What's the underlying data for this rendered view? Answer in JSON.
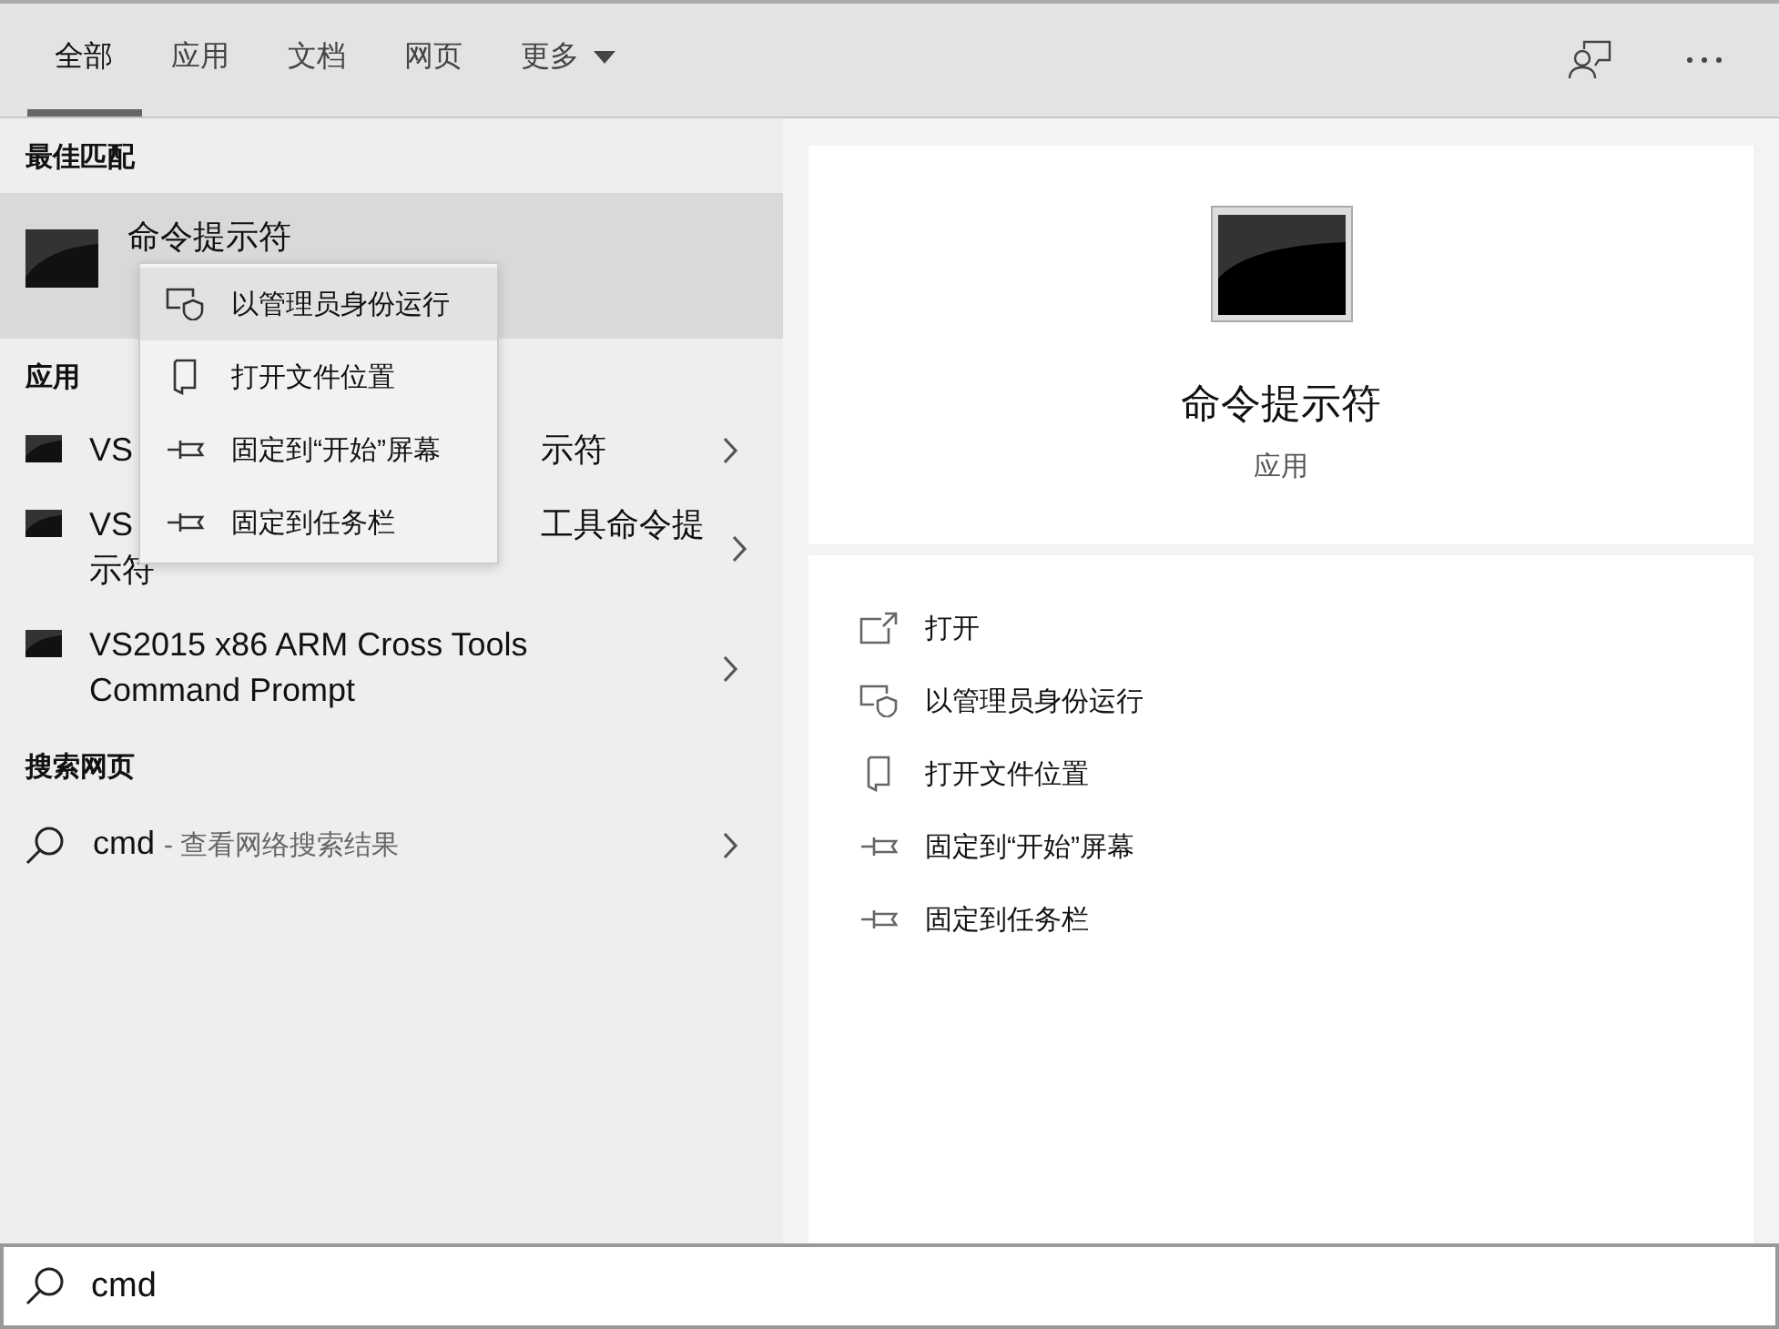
{
  "tabs": [
    {
      "label": "全部",
      "selected": true
    },
    {
      "label": "应用",
      "selected": false
    },
    {
      "label": "文档",
      "selected": false
    },
    {
      "label": "网页",
      "selected": false
    },
    {
      "label": "更多",
      "selected": false,
      "dropdown": true
    }
  ],
  "best_match": {
    "header": "最佳匹配",
    "title": "命令提示符",
    "selected": true
  },
  "context_menu": {
    "items": [
      {
        "label": "以管理员身份运行",
        "kind": "shield",
        "selected": true
      },
      {
        "label": "打开文件位置",
        "kind": "file",
        "selected": false
      },
      {
        "label": "固定到“开始”屏幕",
        "kind": "pin",
        "selected": false
      },
      {
        "label": "固定到任务栏",
        "kind": "pin",
        "selected": false
      }
    ]
  },
  "apps": {
    "header": "应用",
    "items": [
      {
        "kind": "covered",
        "start": "VS",
        "end": "示符"
      },
      {
        "kind": "covered",
        "start": "VS",
        "end": "工具命令提",
        "second_line": "示符"
      },
      {
        "kind": "full",
        "title": "VS2015 x86 ARM Cross Tools Command Prompt"
      }
    ]
  },
  "web": {
    "header": "搜索网页",
    "query": "cmd",
    "hint": "- 查看网络搜索结果"
  },
  "preview": {
    "title": "命令提示符",
    "subtitle": "应用",
    "actions": [
      {
        "label": "打开",
        "kind": "open"
      },
      {
        "label": "以管理员身份运行",
        "kind": "shield"
      },
      {
        "label": "打开文件位置",
        "kind": "file"
      },
      {
        "label": "固定到“开始”屏幕",
        "kind": "pin"
      },
      {
        "label": "固定到任务栏",
        "kind": "pin"
      }
    ]
  },
  "search": {
    "value": "cmd"
  }
}
